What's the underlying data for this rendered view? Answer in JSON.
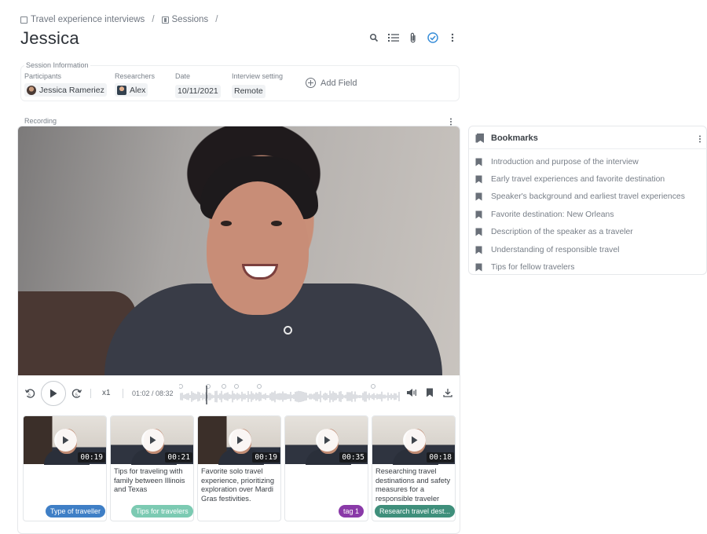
{
  "breadcrumb": {
    "project": "Travel experience interviews",
    "sessions": "Sessions",
    "separator": "/"
  },
  "page": {
    "title": "Jessica"
  },
  "title_actions": [
    "search-icon",
    "list-icon",
    "paperclip-icon",
    "check-circle-icon",
    "more-vertical-icon"
  ],
  "session_info": {
    "label": "Session Information",
    "participants_label": "Participants",
    "participant": "Jessica Rameriez",
    "researchers_label": "Researchers",
    "researcher": "Alex",
    "date_label": "Date",
    "date": "10/11/2021",
    "setting_label": "Interview setting",
    "setting": "Remote",
    "add_field": "Add Field"
  },
  "recording": {
    "label": "Recording",
    "speed": "x1",
    "time": "01:02 / 08:32"
  },
  "clips": [
    {
      "duration": "00:19",
      "text": "",
      "tag": "Type of traveller",
      "tag_color": "#3f7fc6"
    },
    {
      "duration": "00:21",
      "text": "Tips for traveling with family between Illinois and Texas",
      "tag": "Tips for travelers",
      "tag_color": "#7ccab2"
    },
    {
      "duration": "00:19",
      "text": "Favorite solo travel experience, prioritizing exploration over Mardi Gras festivities.",
      "tag": "",
      "tag_color": ""
    },
    {
      "duration": "00:35",
      "text": "",
      "tag": "tag 1",
      "tag_color": "#8a3aa8"
    },
    {
      "duration": "00:18",
      "text": "Researching travel destinations and safety measures for a responsible traveler",
      "tag": "Research travel dest...",
      "tag_color": "#3f8f7b"
    }
  ],
  "bookmarks": {
    "title": "Bookmarks",
    "items": [
      "Introduction and purpose of the interview",
      "Early travel experiences and favorite destination",
      "Speaker's background and earliest travel experiences",
      "Favorite destination: New Orleans",
      "Description of the speaker as a traveler",
      "Understanding of responsible travel",
      "Tips for fellow travelers"
    ]
  },
  "colors": {
    "accent_check": "#3a8fd9",
    "text": "#3a3f45",
    "muted": "#777e87"
  }
}
